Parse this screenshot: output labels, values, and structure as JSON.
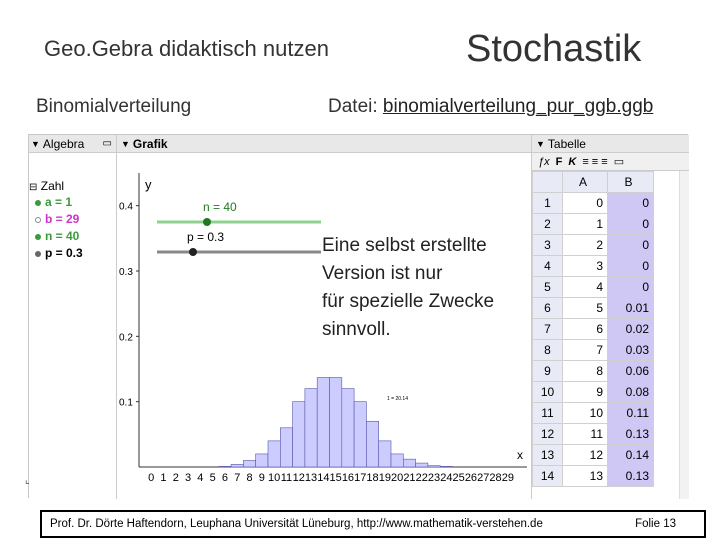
{
  "header": {
    "left_title": "Geo.Gebra didaktisch nutzen",
    "right_title": "Stochastik",
    "subtitle_left": "Binomialverteilung",
    "file_prefix": "Datei: ",
    "file_name": "binomialverteilung_pur_ggb.ggb"
  },
  "algebra": {
    "title": "Algebra",
    "group_label": "Zahl",
    "items": [
      {
        "label": "a = 1",
        "color": "#3a9a3a"
      },
      {
        "label": "b = 29",
        "color": "#cc33cc"
      },
      {
        "label": "n = 40",
        "color": "#3a9a3a"
      },
      {
        "label": "p = 0.3",
        "color": "#000000"
      }
    ]
  },
  "grafik": {
    "title": "Grafik",
    "y_axis_label": "y",
    "x_axis_label": "x",
    "slider_n_label": "n = 40",
    "slider_p_label": "p = 0.3",
    "y_ticks": [
      "0.4",
      "0.3",
      "0.2",
      "0.1"
    ],
    "small_label": "1 = 20.14",
    "slider_n_color": "#8fd18f",
    "slider_p_color": "#888888"
  },
  "chart_data": {
    "type": "bar",
    "categories": [
      "0",
      "1",
      "2",
      "3",
      "4",
      "5",
      "6",
      "7",
      "8",
      "9",
      "10",
      "11",
      "12",
      "13",
      "14",
      "15",
      "16",
      "17",
      "18",
      "19",
      "20",
      "21",
      "22",
      "23",
      "24",
      "25",
      "26",
      "27",
      "28",
      "29"
    ],
    "values": [
      0,
      0,
      0,
      0,
      0,
      0,
      0.001,
      0.004,
      0.01,
      0.02,
      0.04,
      0.06,
      0.1,
      0.12,
      0.137,
      0.137,
      0.12,
      0.1,
      0.07,
      0.04,
      0.02,
      0.012,
      0.006,
      0.002,
      0.001,
      0,
      0,
      0,
      0,
      0
    ],
    "ylim": [
      0,
      0.45
    ],
    "bar_color": "#ccccff",
    "bar_stroke": "#5555aa"
  },
  "tabelle": {
    "title": "Tabelle",
    "toolbar": [
      "F",
      "K"
    ],
    "columns": [
      "A",
      "B"
    ],
    "rows": [
      {
        "n": "1",
        "a": "0",
        "b": "0"
      },
      {
        "n": "2",
        "a": "1",
        "b": "0"
      },
      {
        "n": "3",
        "a": "2",
        "b": "0"
      },
      {
        "n": "4",
        "a": "3",
        "b": "0"
      },
      {
        "n": "5",
        "a": "4",
        "b": "0"
      },
      {
        "n": "6",
        "a": "5",
        "b": "0.01"
      },
      {
        "n": "7",
        "a": "6",
        "b": "0.02"
      },
      {
        "n": "8",
        "a": "7",
        "b": "0.03"
      },
      {
        "n": "9",
        "a": "8",
        "b": "0.06"
      },
      {
        "n": "10",
        "a": "9",
        "b": "0.08"
      },
      {
        "n": "11",
        "a": "10",
        "b": "0.11"
      },
      {
        "n": "12",
        "a": "11",
        "b": "0.13"
      },
      {
        "n": "13",
        "a": "12",
        "b": "0.14"
      },
      {
        "n": "14",
        "a": "13",
        "b": "0.13"
      }
    ]
  },
  "overlay": {
    "lines": [
      "Eine selbst erstellte",
      "Version ist nur",
      "für spezielle Zwecke",
      "sinnvoll."
    ]
  },
  "footer": {
    "text": "Prof. Dr. Dörte Haftendorn, Leuphana Universität Lüneburg, http://www.mathematik-verstehen.de",
    "folie": "Folie 13"
  }
}
